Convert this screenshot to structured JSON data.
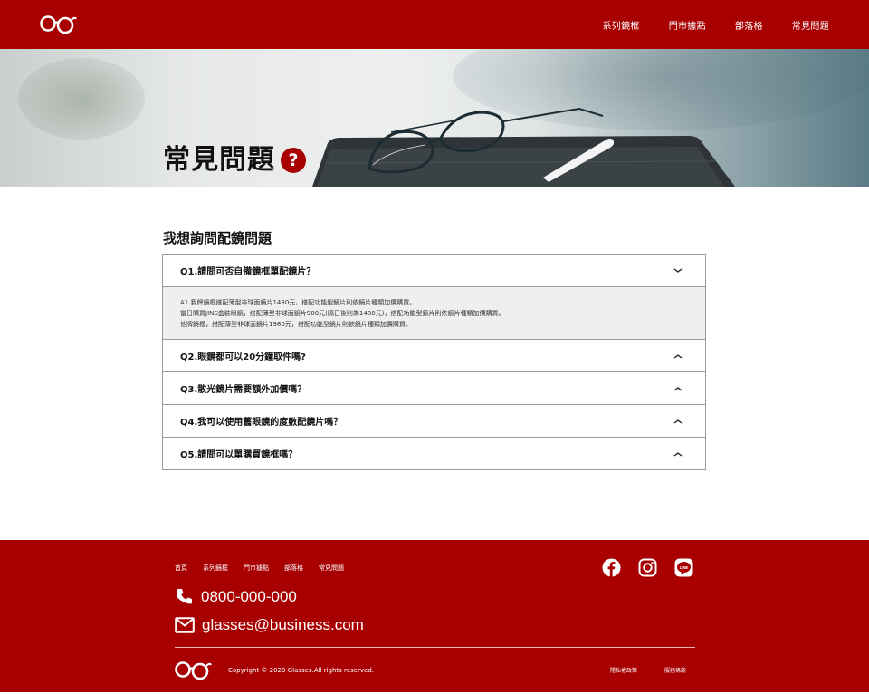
{
  "header": {
    "logo_icon": "glasses-logo",
    "nav": [
      "系列鏡框",
      "門市據點",
      "部落格",
      "常見問題"
    ]
  },
  "hero": {
    "title": "常見問題",
    "badge": "?"
  },
  "section": {
    "title": "我想詢問配鏡問題"
  },
  "faq": [
    {
      "question": "Q1.請問可否自備鏡框單配鏡片？",
      "expanded": true,
      "answer": [
        "A1.我牌鏡框搭配薄型非球面鏡片1480元，搭配功能型鏡片則依鏡片種類加價購買。",
        "當日購買JINS盒裝眼鏡，搭配薄型非球面鏡片980元(隔日後則為1480元)，搭配功能型鏡片則依鏡片種類加價購買。",
        "他牌鏡框，搭配薄型非球面鏡片1980元，搭配功能型鏡片則依鏡片種類加價購買。"
      ]
    },
    {
      "question": "Q2.眼鏡都可以20分鐘取件嗎?",
      "expanded": false
    },
    {
      "question": "Q3.散光鏡片需要額外加價嗎？",
      "expanded": false
    },
    {
      "question": "Q4.我可以使用舊眼鏡的度數配鏡片嗎？",
      "expanded": false
    },
    {
      "question": "Q5.請問可以單購買鏡框嗎？",
      "expanded": false
    }
  ],
  "footer": {
    "nav": [
      "首頁",
      "系列鏡框",
      "門市據點",
      "部落格",
      "常見問題"
    ],
    "social_icons": [
      "facebook-icon",
      "instagram-icon",
      "line-icon"
    ],
    "phone": "0800-000-000",
    "email": "glasses@business.com",
    "copyright": "Copyright © 2020 Glasses.All rights reserved.",
    "legal": [
      "隱私權政策",
      "服務條款"
    ]
  },
  "colors": {
    "brand": "#a80000",
    "answer_bg": "#efefef",
    "border": "#9a9a9a"
  }
}
